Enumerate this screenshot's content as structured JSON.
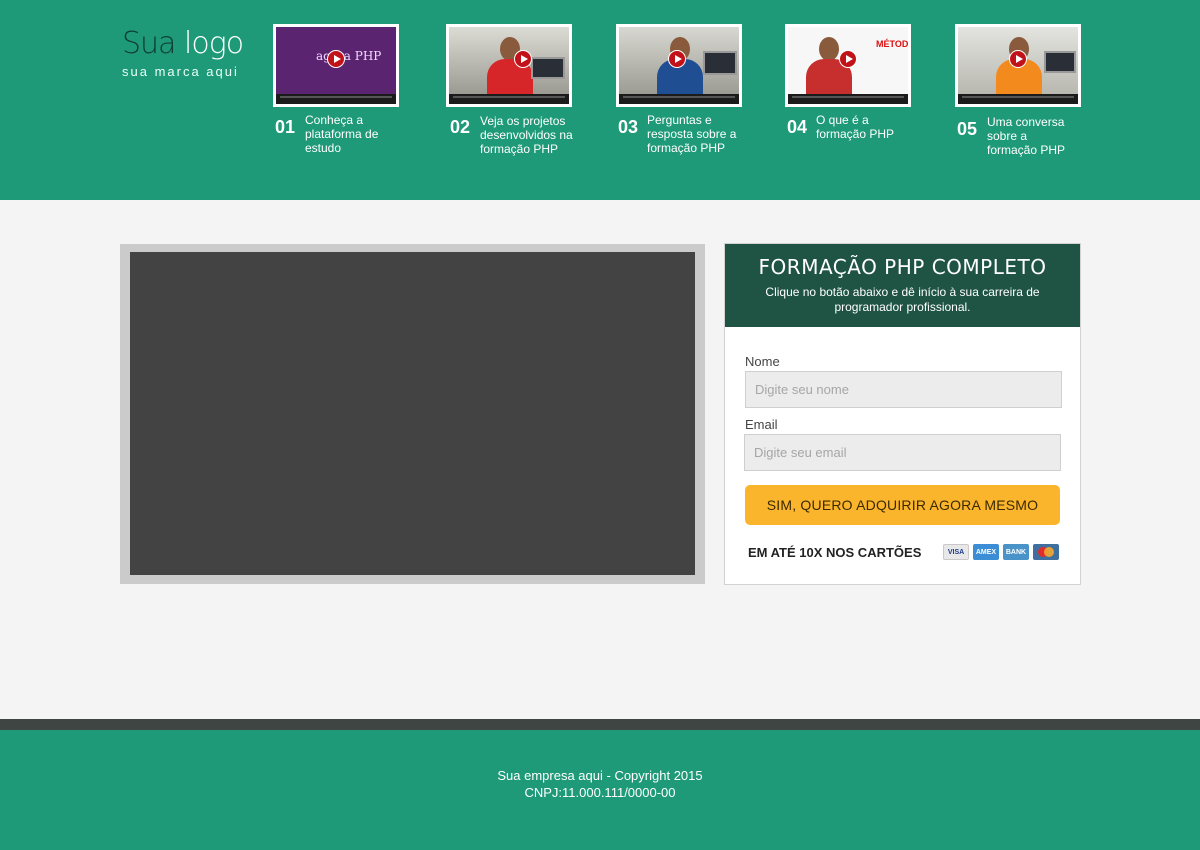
{
  "logo": {
    "main_part1": "Sua",
    "main_part2": "logo",
    "tagline": "sua marca aqui"
  },
  "videos": [
    {
      "number": "01",
      "title": "Conheça a plataforma de estudo",
      "thumb_icon": "play-icon",
      "thumb_brand": "agora PHP"
    },
    {
      "number": "02",
      "title": "Veja os projetos desenvolvidos na formação PHP",
      "thumb_icon": "play-icon"
    },
    {
      "number": "03",
      "title": "Perguntas e resposta sobre a formação PHP",
      "thumb_icon": "play-icon"
    },
    {
      "number": "04",
      "title": "O que é a formação PHP",
      "thumb_icon": "play-icon",
      "thumb_caption": "MÉTODO"
    },
    {
      "number": "05",
      "title": "Uma conversa sobre a formação PHP",
      "thumb_icon": "play-icon"
    }
  ],
  "form": {
    "title": "FORMAÇÃO PHP COMPLETO",
    "subtitle": "Clique no botão abaixo e dê início à sua carreira de programador profissional.",
    "name_label": "Nome",
    "name_placeholder": "Digite seu nome",
    "email_label": "Email",
    "email_placeholder": "Digite seu email",
    "submit_label": "SIM, QUERO ADQUIRIR AGORA MESMO",
    "installments": "EM ATÉ 10X NOS CARTÕES",
    "cards": [
      "VISA",
      "AMEX",
      "BANK",
      "mastercard"
    ]
  },
  "footer": {
    "copyright": "Sua empresa aqui - Copyright 2015",
    "cnpj": "CNPJ:11.000.111/0000-00"
  },
  "colors": {
    "header_bg": "#1e9a78",
    "form_head_bg": "#1f5444",
    "cta_bg": "#fbb52c",
    "video_bg": "#434343"
  }
}
